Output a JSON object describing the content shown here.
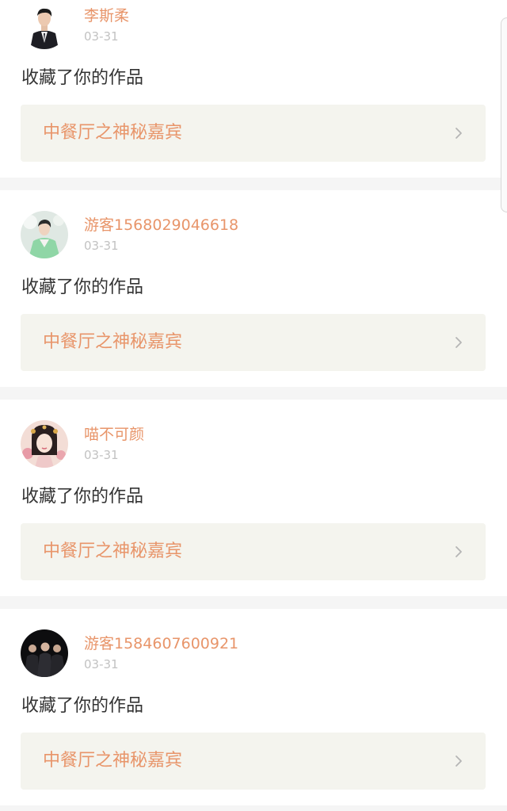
{
  "feed": {
    "items": [
      {
        "username": "李斯柔",
        "date": "03-31",
        "action": "收藏了你的作品",
        "work_title": "中餐厅之神秘嘉宾",
        "avatar_icon": "man-in-suit-avatar-icon"
      },
      {
        "username": "游客1568029046618",
        "date": "03-31",
        "action": "收藏了你的作品",
        "work_title": "中餐厅之神秘嘉宾",
        "avatar_icon": "person-in-green-avatar-icon"
      },
      {
        "username": "喵不可颜",
        "date": "03-31",
        "action": "收藏了你的作品",
        "work_title": "中餐厅之神秘嘉宾",
        "avatar_icon": "illustrated-girl-avatar-icon"
      },
      {
        "username": "游客1584607600921",
        "date": "03-31",
        "action": "收藏了你的作品",
        "work_title": "中餐厅之神秘嘉宾",
        "avatar_icon": "group-photo-avatar-icon"
      }
    ]
  },
  "colors": {
    "accent": "#e8956a",
    "date": "#c2c2c2",
    "text": "#333333",
    "card_link_bg": "#f4f4ee",
    "page_bg": "#f5f5f5"
  }
}
